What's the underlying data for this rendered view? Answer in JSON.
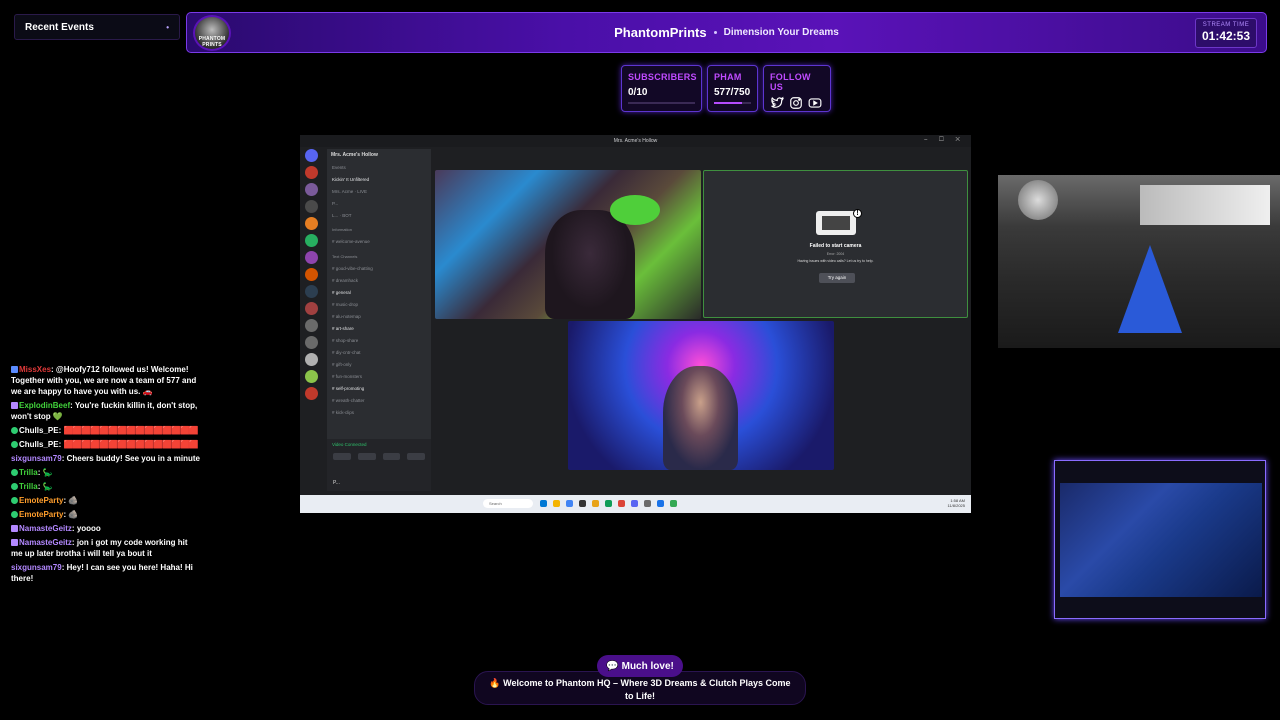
{
  "recent_events": {
    "label": "Recent Events",
    "chevron": "•"
  },
  "header": {
    "logo_text": "PHANTOM PRINTS",
    "brand_name": "PhantomPrints",
    "tagline": "Dimension Your Dreams",
    "stream_time_label": "STREAM TIME",
    "stream_time": "01:42:53"
  },
  "stats": {
    "subscribers": {
      "label": "SUBSCRIBERS",
      "value": "0/10",
      "progress": 0.0
    },
    "pham": {
      "label": "PHAM",
      "value": "577/750",
      "progress": 0.77
    },
    "follow": {
      "label": "FOLLOW US",
      "icons": [
        "twitter-icon",
        "instagram-icon",
        "youtube-icon"
      ]
    }
  },
  "discord": {
    "window_title": "Mrs. Acme's Hollow",
    "server_name": "Mrs. Acme's Hollow",
    "channels": [
      {
        "name": "Events",
        "bright": false
      },
      {
        "name": "Kickin' It Unfiltered",
        "bright": true
      },
      {
        "name": "Mrs. Acme  · LIVE",
        "bright": false
      },
      {
        "name": "P...",
        "bright": false
      },
      {
        "name": "L...  · BOT",
        "bright": false
      },
      {
        "name": "Information",
        "cat": true
      },
      {
        "name": "# welcome-avenue",
        "bright": false
      },
      {
        "name": "Text Channels",
        "cat": true
      },
      {
        "name": "# good-vibe-chatting",
        "bright": false
      },
      {
        "name": "# dreamhack",
        "bright": false
      },
      {
        "name": "# general",
        "bright": true
      },
      {
        "name": "# music-drop",
        "bright": false
      },
      {
        "name": "# alu-notemap",
        "bright": false
      },
      {
        "name": "# art-share",
        "bright": true
      },
      {
        "name": "# shop-share",
        "bright": false
      },
      {
        "name": "# diy-cntr-chat",
        "bright": false
      },
      {
        "name": "# gift-only",
        "bright": false
      },
      {
        "name": "# fun-monsters",
        "bright": false
      },
      {
        "name": "# self-promoting",
        "bright": true
      },
      {
        "name": "# wreath-chatter",
        "bright": false
      },
      {
        "name": "# kick-clips",
        "bright": false
      }
    ],
    "voice_connected": "Video Connected",
    "user_name": "P...",
    "camera_error_title": "Failed to start camera",
    "camera_error_code": "Error: 2004",
    "camera_error_help": "Having issues with video calls? Let us try to help.",
    "try_again_label": "Try again",
    "search_placeholder": "Search",
    "clock": "1:58 AM",
    "date": "11/8/2025"
  },
  "chat": [
    {
      "user": "MissXes",
      "color": "#e23a3a",
      "text": "@Hoofy712 followed us! Welcome! Together with you, we are now a team of 577 and we are happy to have you with us. 🚗",
      "badge": "sq"
    },
    {
      "user": "ExplodinBeef",
      "color": "#41d13b",
      "text": "You're fuckin killin it, don't stop, won't stop 💚",
      "badge": "gift"
    },
    {
      "user": "Chulls_PE",
      "color": "#ffffff",
      "text": "",
      "emotes": "🟥🟥🟥🟥🟥🟥🟥🟥🟥🟥🟥🟥🟥🟥🟥",
      "badge": "dot"
    },
    {
      "user": "Chulls_PE",
      "color": "#ffffff",
      "text": "",
      "emotes": "🟥🟥🟥🟥🟥🟥🟥🟥🟥🟥🟥🟥🟥🟥🟥",
      "badge": "dot"
    },
    {
      "user": "sixgunsam79",
      "color": "#b388ff",
      "text": "Cheers buddy! See you in a minute",
      "badge": ""
    },
    {
      "user": "Trilla",
      "color": "#41d13b",
      "text": "🦕",
      "badge": "dot"
    },
    {
      "user": "Trilla",
      "color": "#41d13b",
      "text": "🦕",
      "badge": "dot"
    },
    {
      "user": "EmoteParty",
      "color": "#ff9e2c",
      "text": "🪨",
      "badge": "dot"
    },
    {
      "user": "EmoteParty",
      "color": "#ff9e2c",
      "text": "🪨",
      "badge": "dot"
    },
    {
      "user": "NamasteGeitz",
      "color": "#b388ff",
      "text": "yoooo",
      "badge": "gift"
    },
    {
      "user": "NamasteGeitz",
      "color": "#b388ff",
      "text": "jon i got my code working hit me up later brotha i will tell ya bout it",
      "badge": "gift"
    },
    {
      "user": "sixgunsam79",
      "color": "#b388ff",
      "text": "Hey! I can see you here! Haha! Hi there!",
      "badge": ""
    }
  ],
  "banners": {
    "much_love": "Much love!",
    "welcome": "Welcome to Phantom HQ – Where 3D Dreams & Clutch Plays Come to Life!"
  },
  "colors": {
    "accent": "#5a12b8",
    "stat_label": "#c04bff"
  }
}
